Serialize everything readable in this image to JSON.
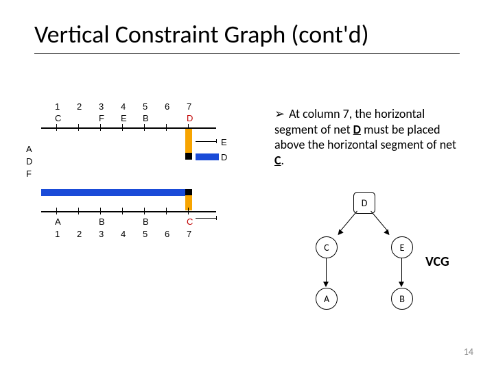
{
  "title": "Vertical Constraint Graph (cont'd)",
  "slide_number": "14",
  "bullet_text_prefix": "At column 7, the horizontal segment of net ",
  "bullet_net1": "D",
  "bullet_text_mid": " must be placed above the horizontal segment of net ",
  "bullet_net2": "C",
  "bullet_period": ".",
  "vcg_label": "VCG",
  "schematic": {
    "left_labels": [
      "A",
      "D",
      "F"
    ],
    "top_cols": [
      "1",
      "2",
      "3",
      "4",
      "5",
      "6",
      "7"
    ],
    "bot_cols": [
      "1",
      "2",
      "3",
      "4",
      "5",
      "6",
      "7"
    ],
    "top_pins": {
      "col1": "C",
      "col3": "F",
      "col4": "E",
      "col5": "B",
      "col7": "D"
    },
    "right_pins": {
      "upper": "E",
      "lower": "D"
    },
    "bot_pins": {
      "col1": "A",
      "col3": "B",
      "col5": "B",
      "col7": "C"
    }
  },
  "vcg_nodes": {
    "D": "D",
    "C": "C",
    "E": "E",
    "A": "A",
    "B": "B"
  },
  "chart_data": {
    "type": "diagram",
    "diagram_type": "channel-routing-with-vcg",
    "channel": {
      "columns": [
        1,
        2,
        3,
        4,
        5,
        6,
        7
      ],
      "top_terminals": [
        "C",
        null,
        "F",
        "E",
        "B",
        null,
        "D"
      ],
      "bottom_terminals": [
        "A",
        null,
        "B",
        null,
        "B",
        null,
        "C"
      ],
      "right_terminals": [
        "E",
        "D"
      ],
      "left_row_labels": [
        "A",
        "D",
        "F"
      ],
      "highlighted_column": 7,
      "highlighted_nets": [
        "D",
        "C"
      ]
    },
    "vcg": {
      "nodes": [
        "A",
        "B",
        "C",
        "D",
        "E"
      ],
      "edges": [
        {
          "from": "D",
          "to": "C"
        },
        {
          "from": "D",
          "to": "E"
        },
        {
          "from": "C",
          "to": "A"
        },
        {
          "from": "E",
          "to": "B"
        }
      ],
      "highlighted_node": "D"
    }
  }
}
